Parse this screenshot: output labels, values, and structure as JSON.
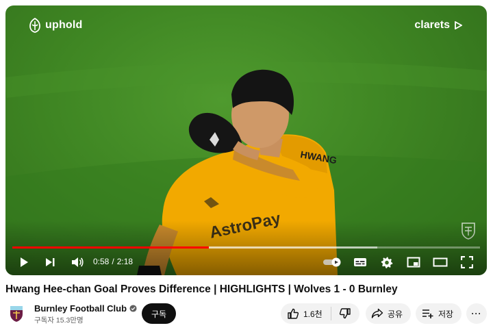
{
  "player": {
    "overlay": {
      "sponsor_logo": "uphold",
      "broadcaster_logo": "clarets"
    },
    "progress": {
      "played_fraction": 0.42,
      "buffered_fraction": 0.78
    },
    "time": {
      "current": "0:58",
      "separator": "/",
      "duration": "2:18"
    },
    "icons": [
      "play-icon",
      "next-icon",
      "volume-icon",
      "autoplay-toggle-icon",
      "subtitles-icon",
      "settings-gear-icon",
      "miniplayer-icon",
      "theater-mode-icon",
      "fullscreen-icon"
    ]
  },
  "video": {
    "title": "Hwang Hee-chan Goal Proves Difference | HIGHLIGHTS | Wolves 1 - 0 Burnley"
  },
  "channel": {
    "name": "Burnley Football Club",
    "verified": true,
    "subscribers": "구독자 15.3만명",
    "subscribe_label": "구독"
  },
  "actions": {
    "like_count": "1.6천",
    "share_label": "공유",
    "save_label": "저장",
    "more_label": "···"
  },
  "colors": {
    "progress_played": "#ff0000",
    "subscribe_bg": "#0f0f0f",
    "pill_bg": "#f2f2f2",
    "jersey": "#f2a900",
    "pitch": "#3f8623"
  }
}
